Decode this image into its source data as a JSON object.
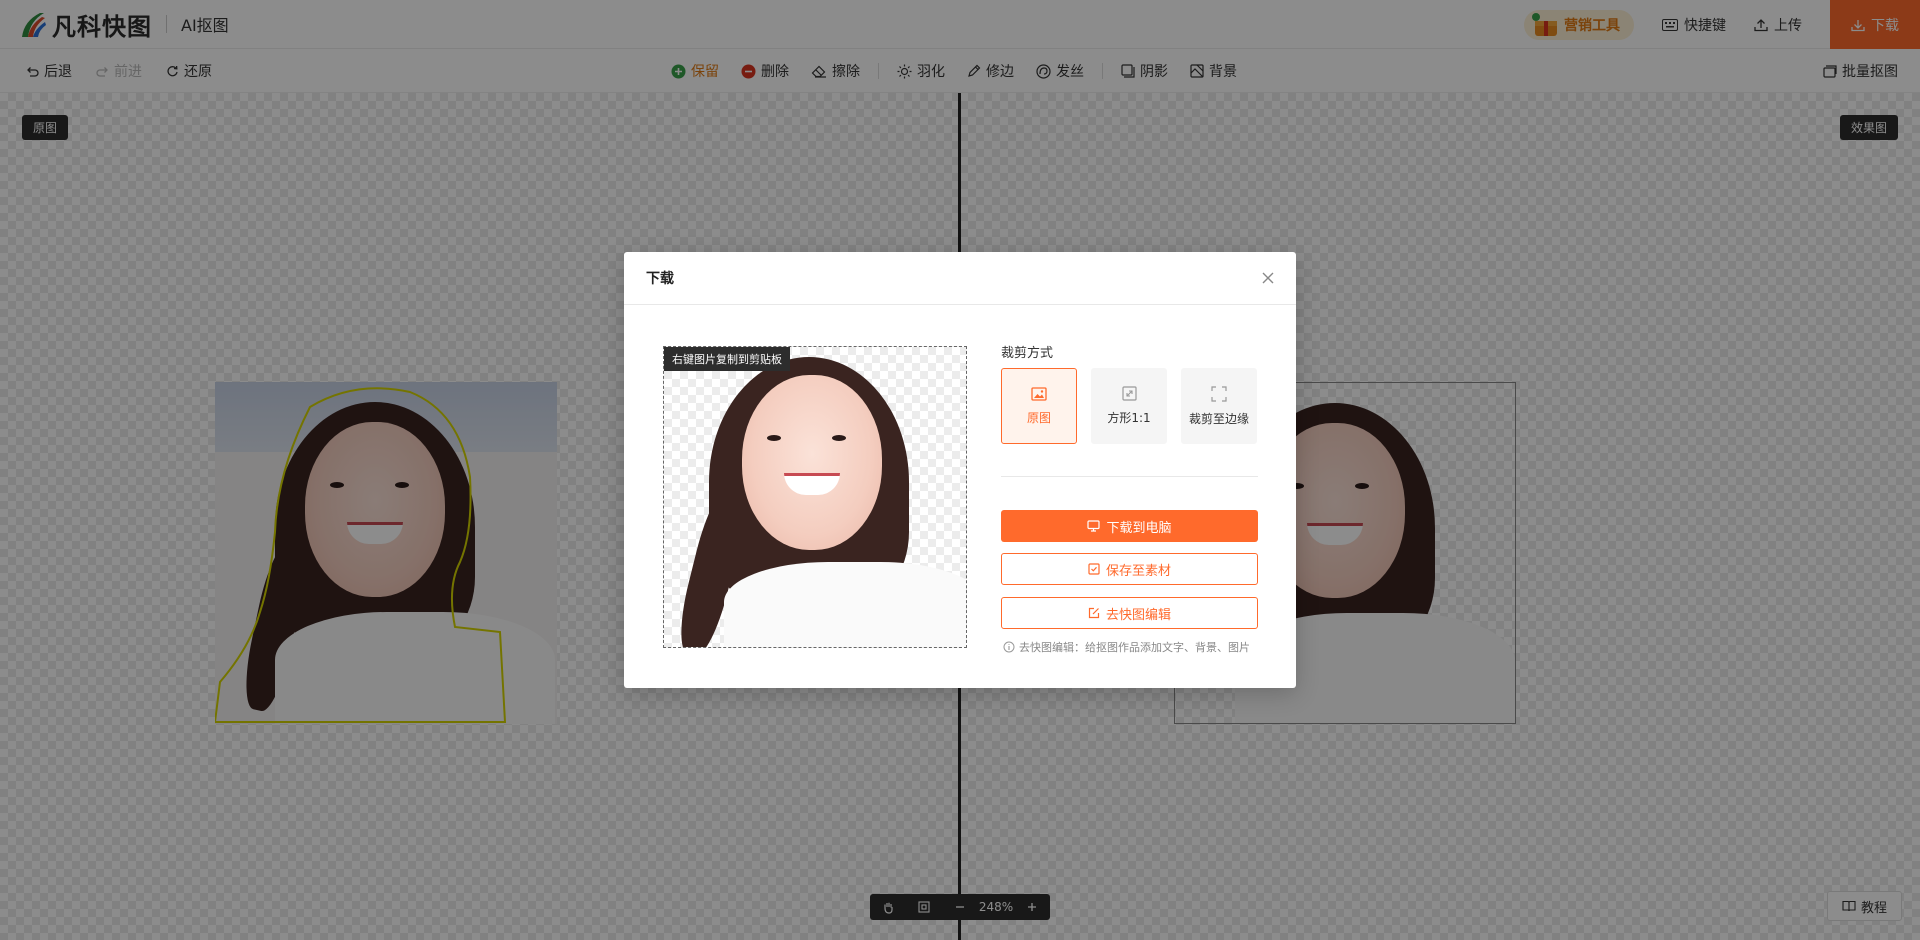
{
  "header": {
    "logo_text": "凡科快图",
    "app_name": "AI抠图",
    "promo_label": "营销工具",
    "shortcut_label": "快捷键",
    "upload_label": "上传",
    "download_label": "下载"
  },
  "toolbar": {
    "back": "后退",
    "forward": "前进",
    "restore": "还原",
    "keep": "保留",
    "delete": "删除",
    "erase": "擦除",
    "feather": "羽化",
    "trim": "修边",
    "hair": "发丝",
    "shadow": "阴影",
    "background": "背景",
    "batch": "批量抠图"
  },
  "canvas": {
    "original_tag": "原图",
    "result_tag": "效果图"
  },
  "modal": {
    "title": "下载",
    "preview_tip": "右键图片复制到剪贴板",
    "crop_label": "裁剪方式",
    "crop_options": [
      "原图",
      "方形1:1",
      "裁剪至边缘"
    ],
    "download_pc": "下载到电脑",
    "save_material": "保存至素材",
    "go_edit": "去快图编辑",
    "hint": "去快图编辑：给抠图作品添加文字、背景、图片"
  },
  "zoom": {
    "value": "248%"
  },
  "tutorial_label": "教程",
  "colors": {
    "accent": "#ff6a2c",
    "dark": "#2d2d2d"
  }
}
